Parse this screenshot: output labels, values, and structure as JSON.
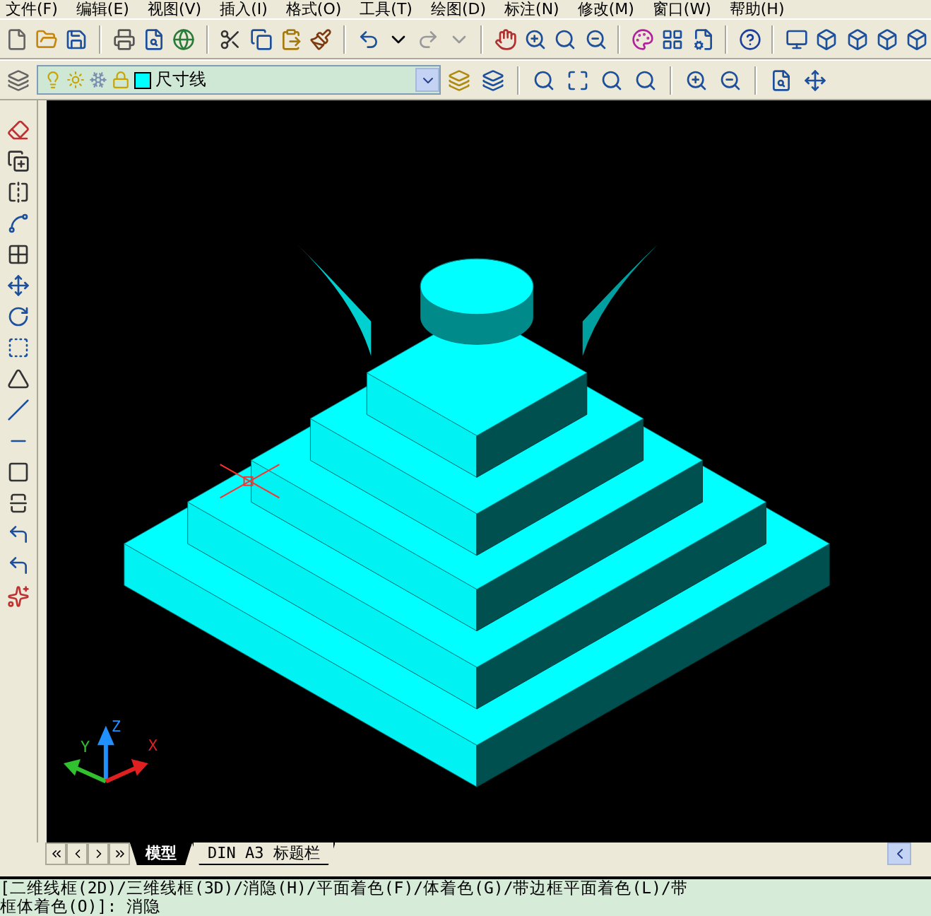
{
  "menu": [
    "文件(F)",
    "编辑(E)",
    "视图(V)",
    "插入(I)",
    "格式(O)",
    "工具(T)",
    "绘图(D)",
    "标注(N)",
    "修改(M)",
    "窗口(W)",
    "帮助(H)"
  ],
  "layer": {
    "name": "尺寸线",
    "color": "#00ffff"
  },
  "ucs": {
    "x": "X",
    "y": "Y",
    "z": "Z"
  },
  "tabs": [
    {
      "label": "模型",
      "selected": true
    },
    {
      "label": "DIN A3 标题栏",
      "selected": false
    }
  ],
  "command_lines": [
    "[二维线框(2D)/三维线框(3D)/消隐(H)/平面着色(F)/体着色(G)/带边框平面着色(L)/带",
    "框体着色(O)]: 消隐"
  ]
}
